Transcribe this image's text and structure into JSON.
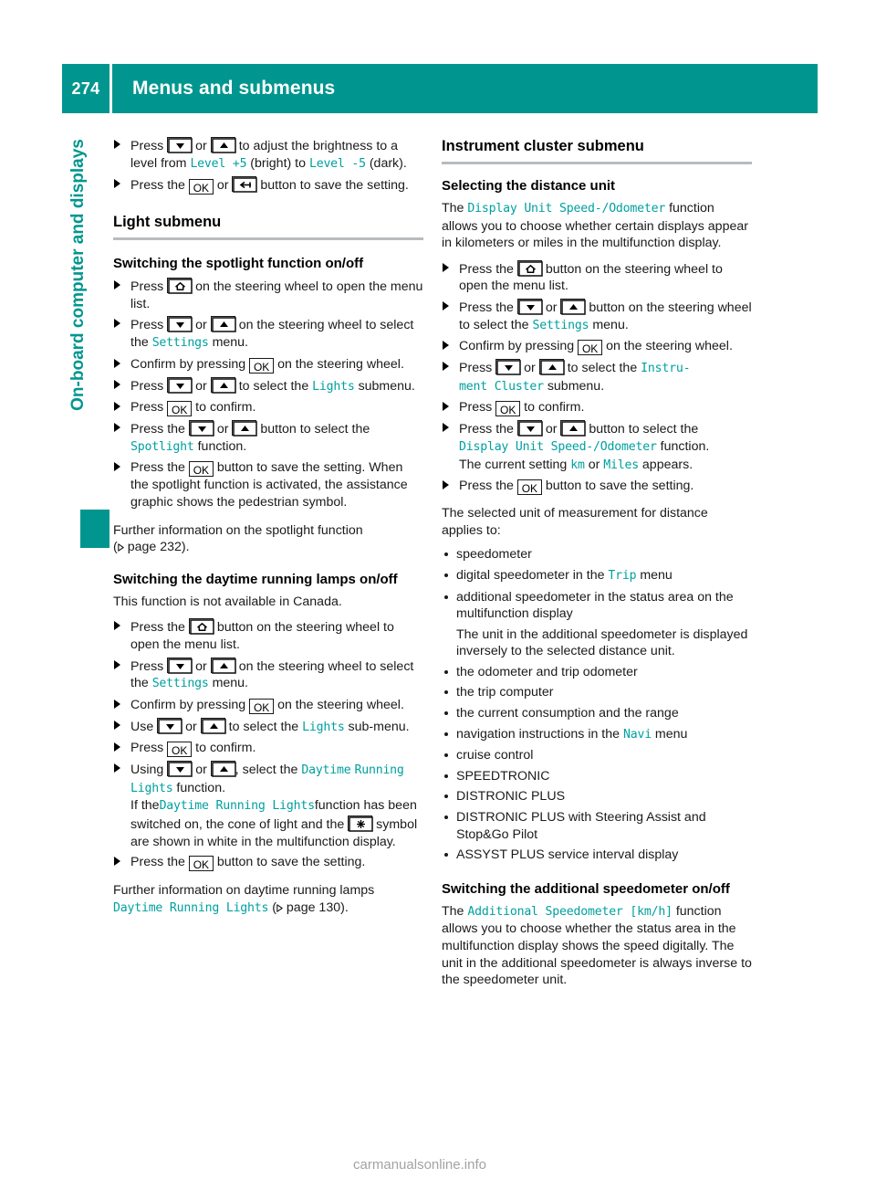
{
  "header": {
    "page_number": "274",
    "title": "Menus and submenus",
    "accent_color": "#00968f"
  },
  "sidebar": {
    "chapter_label": "On-board computer and displays",
    "marker_color": "#00968f"
  },
  "footer": {
    "watermark": "carmanualsonline.info"
  },
  "left_column": {
    "steps_brightness": [
      {
        "parts": [
          {
            "t": "text",
            "v": "Press "
          },
          {
            "t": "key",
            "v": "down-arrow-key"
          },
          {
            "t": "text",
            "v": " or "
          },
          {
            "t": "key",
            "v": "up-arrow-key"
          },
          {
            "t": "text",
            "v": " to adjust the brightness to a level from "
          },
          {
            "t": "code",
            "v": "Level +5"
          },
          {
            "t": "text",
            "v": " (bright) to "
          },
          {
            "t": "code",
            "v": "Level -5"
          },
          {
            "t": "text",
            "v": " (dark)."
          }
        ]
      },
      {
        "parts": [
          {
            "t": "text",
            "v": "Press the "
          },
          {
            "t": "key",
            "v": "ok-key"
          },
          {
            "t": "text",
            "v": " or "
          },
          {
            "t": "key",
            "v": "back-key"
          },
          {
            "t": "text",
            "v": " button to save the setting."
          }
        ]
      }
    ],
    "light_submenu_heading": "Light submenu",
    "spotlight_heading": "Switching the spotlight function on/off",
    "spotlight_steps": [
      "Press HOME on the steering wheel to open the menu list.",
      "Press DOWN or UP on the steering wheel to select the Settings menu.",
      "Confirm by pressing OK on the steering wheel.",
      "Press DOWN or UP to select the Lights submenu.",
      "Press OK to confirm.",
      "Press the DOWN or UP button to select the Spotlight function.",
      "Press the OK button to save the setting."
    ],
    "spotlight_note": "When the spotlight function is activated, the assistance graphic shows the pedestrian symbol.",
    "spotlight_further": "Further information on the spotlight function",
    "spotlight_further_page": "page 232).",
    "drl_heading": "Switching the daytime running lamps on/off",
    "drl_intro": "This function is not available in Canada.",
    "drl_note_prefix": "If the",
    "drl_note_mid": "function has been switched on, the cone of light and the",
    "drl_note_suffix": "symbol are shown in white in the multifunction display.",
    "drl_further": "Further information on daytime running lamps",
    "drl_further_code": "Daytime Running Lights",
    "drl_further_page": "page 130).",
    "codes": {
      "level_bright": "Level +5",
      "level_dark": "Level -5",
      "settings": "Settings",
      "lights": "Lights",
      "spotlight": "Spotlight",
      "daytime": "Daytime",
      "running_lights": "Running Lights",
      "daytime_running_lights": "Daytime Running Lights"
    },
    "labels": {
      "press": "Press",
      "press_the": "Press the",
      "or": "or",
      "use": "Use",
      "using": "Using",
      "confirm_by_pressing": "Confirm by pressing",
      "on_steering_wheel_open": "on the steering wheel to open the menu list.",
      "button_on_steering_wheel_open": "button on the steering wheel to open the menu list.",
      "on_steering_wheel_select": "on the steering wheel to select the",
      "menu": "menu.",
      "on_the_steering_wheel": "on the steering",
      "wheel_period": "wheel.",
      "to_select_the": "to select the",
      "submenu": "submenu.",
      "sub_menu_hyphen": "sub-menu.",
      "to_confirm": "to confirm.",
      "button_to_select_the": "button to select the",
      "function": "function.",
      "button_to_save": "button to save the setting.",
      "select_the": ", select the"
    }
  },
  "right_column": {
    "cluster_heading": "Instrument cluster submenu",
    "distance_heading": "Selecting the distance unit",
    "distance_intro_prefix": "The",
    "distance_intro_code": "Display Unit Speed-/Odometer",
    "distance_intro_suffix": "function allows you to choose whether certain displays appear in kilometers or miles in the multifunction display.",
    "codes": {
      "display_unit": "Display Unit Speed-/Odometer",
      "settings": "Settings",
      "instru": "Instru-",
      "ment_cluster": "ment Cluster",
      "km": "km",
      "miles": "Miles",
      "trip": "Trip",
      "navi": "Navi",
      "additional_speedometer": "Additional Speedometer [km/h]"
    },
    "selected_unit_intro": "The selected unit of measurement for distance applies to:",
    "applies_list": [
      "speedometer",
      "digital speedometer in the Trip menu",
      "additional speedometer in the status area on the multifunction display",
      "the odometer and trip odometer",
      "the trip computer",
      "the current consumption and the range",
      "navigation instructions in the Navi menu",
      "cruise control",
      "SPEEDTRONIC",
      "DISTRONIC PLUS",
      "DISTRONIC PLUS with Steering Assist and Stop&Go Pilot",
      "ASSYST PLUS service interval display"
    ],
    "inverse_note": "The unit in the additional speedometer is displayed inversely to the selected distance unit.",
    "addspeedo_heading": "Switching the additional speedometer on/off",
    "addspeedo_prefix": "The",
    "addspeedo_suffix": "function allows you to choose whether the status area in the multifunction display shows the speed digitally. The unit in the additional speedometer is always inverse to the speedometer unit.",
    "current_setting_prefix": "The current setting",
    "current_setting_or": "or",
    "current_setting_suffix": "appears."
  }
}
